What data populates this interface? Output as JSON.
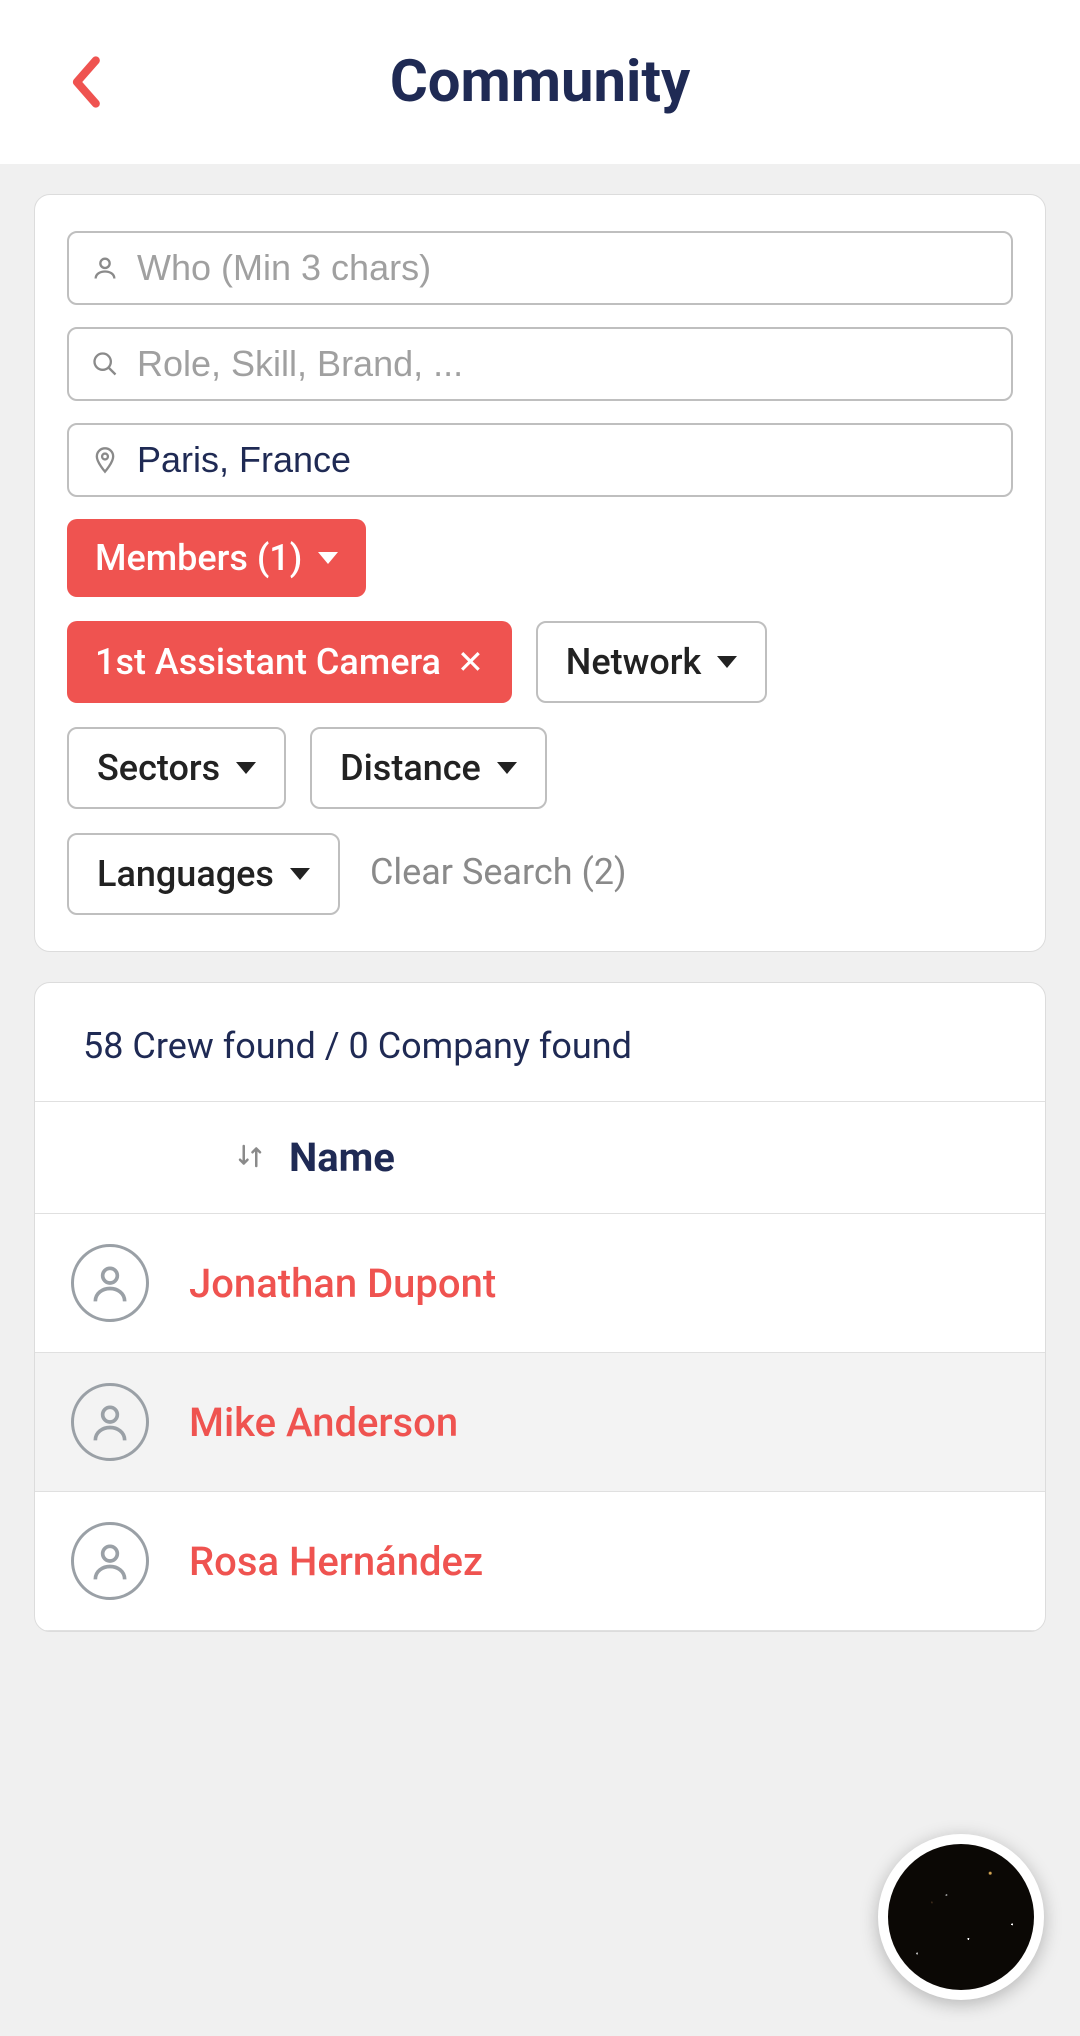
{
  "header": {
    "title": "Community"
  },
  "search": {
    "who_placeholder": "Who (Min 3 chars)",
    "who_value": "",
    "role_placeholder": "Role, Skill, Brand, ...",
    "role_value": "",
    "location_value": "Paris, France"
  },
  "filters": {
    "members": "Members (1)",
    "role_tag": "1st Assistant Camera",
    "network": "Network",
    "sectors": "Sectors",
    "distance": "Distance",
    "languages": "Languages",
    "clear": "Clear Search (2)"
  },
  "results": {
    "summary": "58 Crew found / 0 Company found",
    "sort_label": "Name",
    "items": [
      {
        "name": "Jonathan Dupont"
      },
      {
        "name": "Mike Anderson"
      },
      {
        "name": "Rosa Hernández"
      }
    ]
  }
}
